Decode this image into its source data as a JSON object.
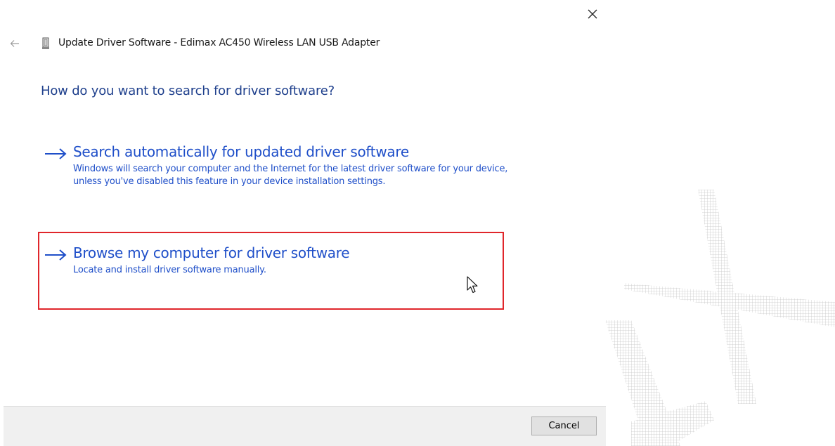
{
  "window": {
    "title": "Update Driver Software - Edimax AC450 Wireless LAN USB Adapter",
    "close_icon": "close-icon",
    "back_icon": "back-arrow-icon",
    "device_icon": "usb-adapter-icon"
  },
  "main": {
    "instruction": "How do you want to search for driver software?",
    "options": [
      {
        "icon": "arrow-right-icon",
        "title": "Search automatically for updated driver software",
        "description": "Windows will search your computer and the Internet for the latest driver software for your device, unless you've disabled this feature in your device installation settings."
      },
      {
        "icon": "arrow-right-icon",
        "title": "Browse my computer for driver software",
        "description": "Locate and install driver software manually."
      }
    ]
  },
  "footer": {
    "cancel_label": "Cancel"
  },
  "colors": {
    "link_blue": "#1f4fc9",
    "instruction_blue": "#1e3f8c",
    "highlight_red": "#e0262b",
    "footer_gray": "#f0f0f0"
  }
}
